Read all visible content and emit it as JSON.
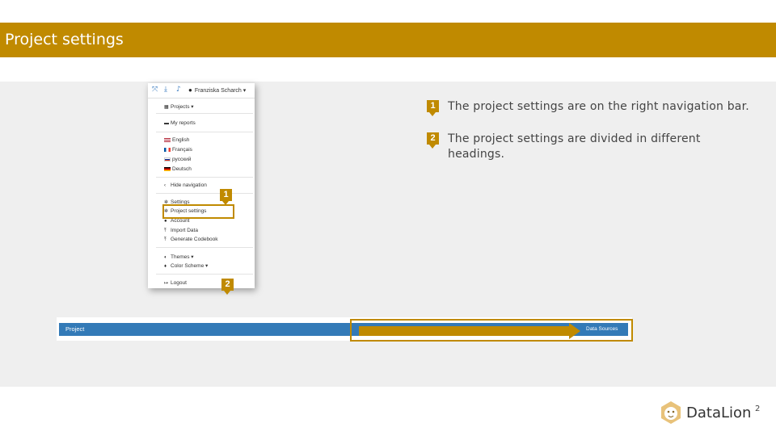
{
  "slide": {
    "title": "Project settings",
    "page_number": "2"
  },
  "menu": {
    "top_icons": [
      "expand-icon",
      "download-icon",
      "bell-icon"
    ],
    "user_name": "Franziska Scharch ▾",
    "items": {
      "projects": "Projects ▾",
      "my_reports": "My reports",
      "english": "English",
      "francais": "Français",
      "russian": "русский",
      "deutsch": "Deutsch",
      "hide_navigation": "Hide navigation",
      "settings": "Settings",
      "project_settings": "Project settings",
      "account": "Account",
      "import_data": "Import Data",
      "generate_codebook": "Generate Codebook",
      "themes": "Themes ▾",
      "color_scheme": "Color Scheme ▾",
      "logout": "Logout"
    }
  },
  "project_bar": {
    "label": "Project",
    "data_sources": "Data Sources"
  },
  "markers": {
    "one": "1",
    "two": "2"
  },
  "points": [
    {
      "number": "1",
      "text": "The project settings are on the right navigation bar."
    },
    {
      "number": "2",
      "text": "The project settings are divided in different headings."
    }
  ],
  "logo": {
    "text": "DataLion"
  },
  "colors": {
    "accent": "#c08a00",
    "bar_blue": "#337ab7",
    "content_bg": "#efefef"
  }
}
